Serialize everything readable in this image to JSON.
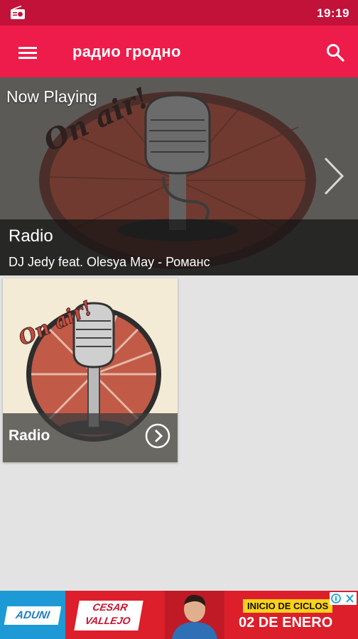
{
  "status_bar": {
    "time": "19:19",
    "icon": "radio-icon"
  },
  "app_bar": {
    "title": "радио гродно",
    "menu_icon": "hamburger-menu-icon",
    "search_icon": "search-icon"
  },
  "now_playing": {
    "label": "Now Playing",
    "station": "Radio",
    "track": "DJ Jedy feat. Olesya May  -  Романс",
    "logo_text": "On air!",
    "next_icon": "chevron-right-icon"
  },
  "stations": [
    {
      "name": "Radio",
      "logo_text": "On air!",
      "play_icon": "chevron-right-circle-icon"
    }
  ],
  "ad": {
    "brand1": "ADUNI",
    "brand2_line1": "CESAR",
    "brand2_line2": "VALLEJO",
    "headline": "INICIO DE CICLOS",
    "date": "02 DE ENERO"
  },
  "colors": {
    "status_bar": "#c2123a",
    "app_bar": "#ee1c4a",
    "background": "#e3e3e3",
    "ad": "#dc1f2b"
  }
}
